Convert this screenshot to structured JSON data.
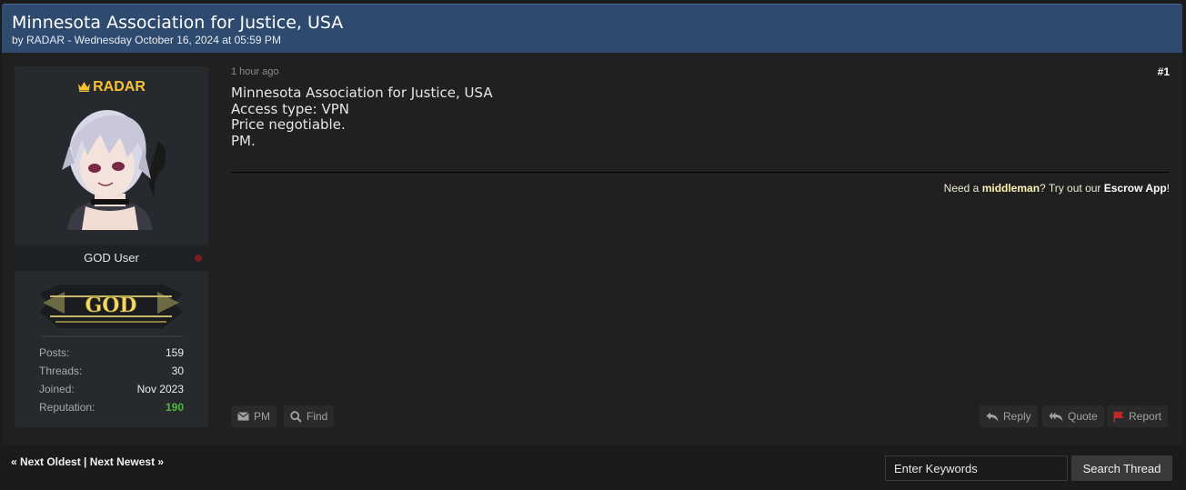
{
  "thread": {
    "title": "Minnesota Association for Justice, USA",
    "meta": "by RADAR - Wednesday October 16, 2024 at 05:59 PM"
  },
  "author": {
    "name": "RADAR",
    "usertitle": "GOD User",
    "badge_text": "GOD",
    "stats": [
      {
        "label": "Posts:",
        "value": "159"
      },
      {
        "label": "Threads:",
        "value": "30"
      },
      {
        "label": "Joined:",
        "value": "Nov 2023"
      },
      {
        "label": "Reputation:",
        "value": "190"
      }
    ]
  },
  "post": {
    "time": "1 hour ago",
    "number": "#1",
    "lines": [
      "Minnesota Association for Justice, USA",
      "Access type: VPN",
      "Price negotiable.",
      "PM."
    ],
    "signature": {
      "pre": "Need a ",
      "highlight": "middleman",
      "mid": "? Try out our ",
      "app": "Escrow App",
      "post": "!"
    }
  },
  "buttons": {
    "pm": "PM",
    "find": "Find",
    "reply": "Reply",
    "quote": "Quote",
    "report": "Report"
  },
  "footer": {
    "prev": "« Next Oldest",
    "sep": " | ",
    "next": "Next Newest »",
    "search_placeholder": "Enter Keywords",
    "search_button": "Search Thread"
  },
  "colors": {
    "header_bg": "#2e4a6e",
    "username": "#f5c331",
    "reputation": "#4fbb3d",
    "report_flag": "#c0262a"
  }
}
